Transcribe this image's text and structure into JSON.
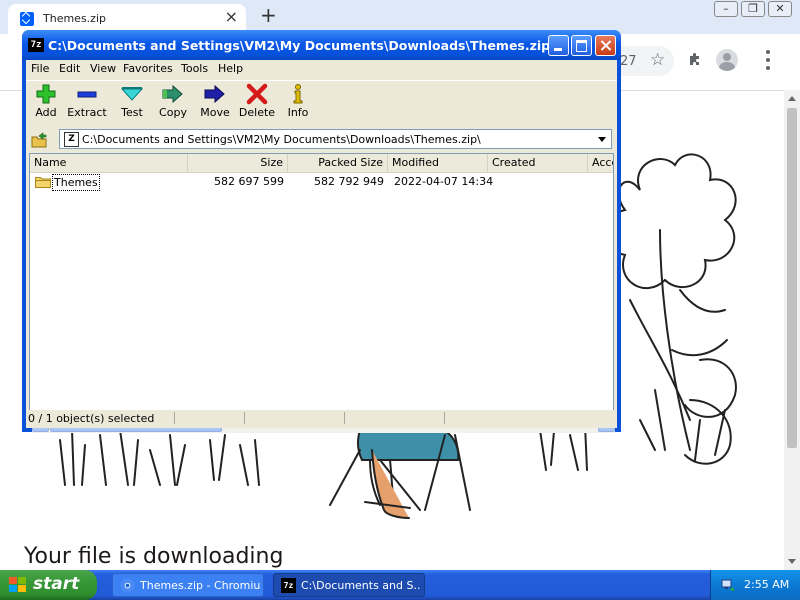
{
  "browser": {
    "tab_title": "Themes.zip",
    "new_tab_symbol": "+",
    "omnibox_partial_text": "27",
    "page_heading": "Your file is downloading"
  },
  "zip_window": {
    "title": "C:\\Documents and Settings\\VM2\\My Documents\\Downloads\\Themes.zip\\",
    "title_icon_text": "7z",
    "menu": [
      "File",
      "Edit",
      "View",
      "Favorites",
      "Tools",
      "Help"
    ],
    "toolbar": [
      {
        "label": "Add",
        "icon": "plus-icon"
      },
      {
        "label": "Extract",
        "icon": "minus-icon"
      },
      {
        "label": "Test",
        "icon": "test-check-icon"
      },
      {
        "label": "Copy",
        "icon": "copy-arrow-icon"
      },
      {
        "label": "Move",
        "icon": "move-arrow-icon"
      },
      {
        "label": "Delete",
        "icon": "delete-x-icon"
      },
      {
        "label": "Info",
        "icon": "info-icon"
      }
    ],
    "address": "C:\\Documents and Settings\\VM2\\My Documents\\Downloads\\Themes.zip\\",
    "columns": [
      "Name",
      "Size",
      "Packed Size",
      "Modified",
      "Created",
      "Acce"
    ],
    "rows": [
      {
        "name": "Themes",
        "size": "582 697 599",
        "packed_size": "582 792 949",
        "modified": "2022-04-07 14:34",
        "created": ""
      }
    ],
    "status": "0 / 1 object(s) selected"
  },
  "taskbar": {
    "start_label": "start",
    "tasks": [
      {
        "label": "Themes.zip - Chromium",
        "icon": "chromium-icon",
        "active": false
      },
      {
        "label": "C:\\Documents and S...",
        "icon": "sevenzip-icon",
        "active": true
      }
    ],
    "clock": "2:55 AM"
  },
  "colors": {
    "xp_title_blue": "#0a57e6",
    "xp_start_green": "#3a9a3a",
    "window_face": "#ece9d8",
    "chrome_frame": "#dfe8f7"
  }
}
